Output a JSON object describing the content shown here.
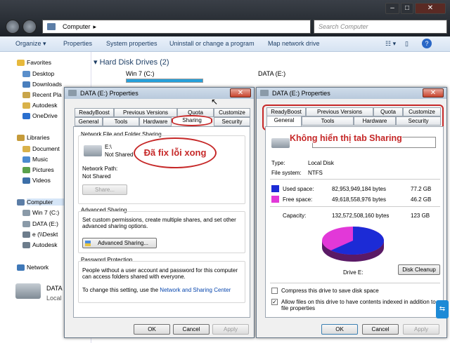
{
  "explorer": {
    "address": "Computer",
    "search_placeholder": "Search Computer",
    "toolbar": [
      "Organize ▾",
      "Properties",
      "System properties",
      "Uninstall or change a program",
      "Map network drive"
    ],
    "section_title": "Hard Disk Drives (2)",
    "drives": [
      {
        "label": "Win 7 (C:)"
      },
      {
        "label": "DATA (E:)"
      }
    ],
    "nav": {
      "favorites": "Favorites",
      "fav_items": [
        "Desktop",
        "Downloads",
        "Recent Pla",
        "Autodesk",
        "OneDrive"
      ],
      "libraries": "Libraries",
      "lib_items": [
        "Document",
        "Music",
        "Pictures",
        "Videos"
      ],
      "computer": "Computer",
      "comp_items": [
        "Win 7 (C:)",
        "DATA (E:)",
        "e (\\\\Deskt",
        "Autodesk"
      ],
      "network": "Network"
    },
    "details": {
      "name": "DATA",
      "sub": "Local"
    }
  },
  "left_dialog": {
    "title": "DATA (E:) Properties",
    "tabs_top": [
      "ReadyBoost",
      "Previous Versions",
      "Quota",
      "Customize"
    ],
    "tabs_bottom": [
      "General",
      "Tools",
      "Hardware",
      "Sharing",
      "Security"
    ],
    "net_share_group": "Network File and Folder Sharing",
    "drive_path": "E:\\",
    "shared_status": "Not Shared",
    "net_path_label": "Network Path:",
    "net_path_value": "Not Shared",
    "share_button": "Share...",
    "adv_group": "Advanced Sharing",
    "adv_desc": "Set custom permissions, create multiple shares, and set other advanced sharing options.",
    "adv_button": "Advanced Sharing...",
    "pwd_group": "Password Protection",
    "pwd_desc": "People without a user account and password for this computer can access folders shared with everyone.",
    "pwd_link_prefix": "To change this setting, use the ",
    "pwd_link": "Network and Sharing Center",
    "ok": "OK",
    "cancel": "Cancel",
    "apply": "Apply",
    "annotation": "Đã fix lỗi xong"
  },
  "right_dialog": {
    "title": "DATA (E:) Properties",
    "tabs_top": [
      "ReadyBoost",
      "Previous Versions",
      "Quota",
      "Customize"
    ],
    "tabs_bottom": [
      "General",
      "Tools",
      "Hardware",
      "Security"
    ],
    "annotation": "Không hiển thị tab Sharing",
    "type_label": "Type:",
    "type_value": "Local Disk",
    "fs_label": "File system:",
    "fs_value": "NTFS",
    "used_label": "Used space:",
    "used_bytes": "82,953,949,184 bytes",
    "used_gb": "77.2 GB",
    "free_label": "Free space:",
    "free_bytes": "49,618,558,976 bytes",
    "free_gb": "46.2 GB",
    "cap_label": "Capacity:",
    "cap_bytes": "132,572,508,160 bytes",
    "cap_gb": "123 GB",
    "drive_caption": "Drive E:",
    "cleanup": "Disk Cleanup",
    "compress": "Compress this drive to save disk space",
    "index": "Allow files on this drive to have contents indexed in addition to file properties",
    "ok": "OK",
    "cancel": "Cancel",
    "apply": "Apply",
    "used_color": "#1c2bd6",
    "free_color": "#e238d8",
    "used_fraction": 0.626
  }
}
